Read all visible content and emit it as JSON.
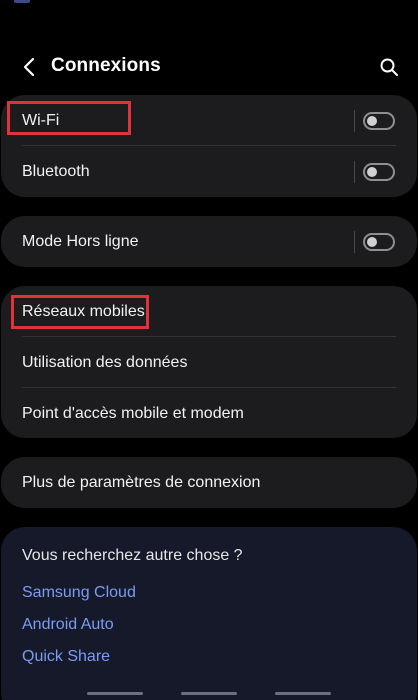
{
  "header": {
    "title": "Connexions",
    "back_icon": "chevron-left-icon",
    "search_icon": "search-icon"
  },
  "group1": {
    "items": [
      {
        "label": "Wi-Fi",
        "toggle": "off",
        "highlighted": true
      },
      {
        "label": "Bluetooth",
        "toggle": "off",
        "highlighted": false
      }
    ]
  },
  "group2": {
    "items": [
      {
        "label": "Mode Hors ligne",
        "toggle": "off"
      }
    ]
  },
  "group3": {
    "items": [
      {
        "label": "Réseaux mobiles",
        "highlighted": true
      },
      {
        "label": "Utilisation des données"
      },
      {
        "label": "Point d'accès mobile et modem"
      }
    ]
  },
  "group4": {
    "items": [
      {
        "label": "Plus de paramètres de connexion"
      }
    ]
  },
  "suggestions": {
    "title": "Vous recherchez autre chose ?",
    "links": [
      "Samsung Cloud",
      "Android Auto",
      "Quick Share"
    ]
  },
  "colors": {
    "background": "#000000",
    "card": "#1c1c1e",
    "suggest_card": "#15192a",
    "link": "#7b9cf0",
    "highlight": "#e0323a"
  }
}
